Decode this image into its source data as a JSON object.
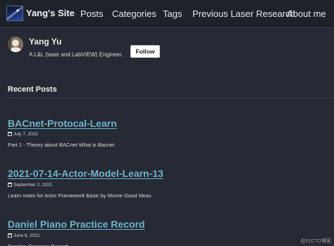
{
  "site": {
    "brand": "Yang's Site",
    "nav": [
      "Posts",
      "Categories",
      "Tags",
      "Previous Laser Research",
      "About me"
    ]
  },
  "author": {
    "name": "Yang Yu",
    "bio": "A L&L (laser and LabVIEW) Engineer.",
    "follow_label": "Follow"
  },
  "recent": {
    "title": "Recent Posts",
    "posts": [
      {
        "title": "BACnet-Protocal-Learn",
        "date": "July 7, 2022",
        "excerpt": "Part 1 - Theory about BACnet What is Bacnet"
      },
      {
        "title": "2021-07-14-Actor-Model-Learn-13",
        "date": "September 2, 2021",
        "excerpt": "Learn notes for Actor Framework Basic by Moore Good Ideas"
      },
      {
        "title": "Daniel Piano Practice Record",
        "date": "June 6, 2021",
        "excerpt": "Practice Progress Record"
      }
    ]
  },
  "watermark": "@51CTO博客",
  "icons": {
    "date": "calendar-icon"
  }
}
